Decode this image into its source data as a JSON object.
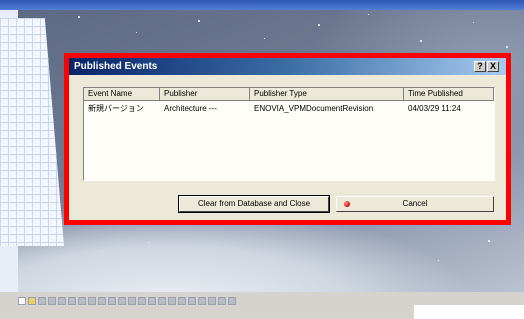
{
  "dialog": {
    "title": "Published Events",
    "help_label": "?",
    "close_label": "X",
    "columns": [
      "Event Name",
      "Publisher",
      "Publisher Type",
      "Time Published"
    ],
    "rows": [
      [
        "新規バージョン",
        "Architecture ---",
        "ENOVIA_VPMDocumentRevision",
        "04/03/29 11:24"
      ]
    ],
    "clear_button": "Clear from Database and Close",
    "cancel_button": "Cancel"
  },
  "colors": {
    "highlight_frame": "#ff0000",
    "dialog_bg": "#ece9d8",
    "title_bar": "#0a246a"
  },
  "icons": [
    "help-icon",
    "close-icon",
    "cancel-icon",
    "earth-logo"
  ]
}
